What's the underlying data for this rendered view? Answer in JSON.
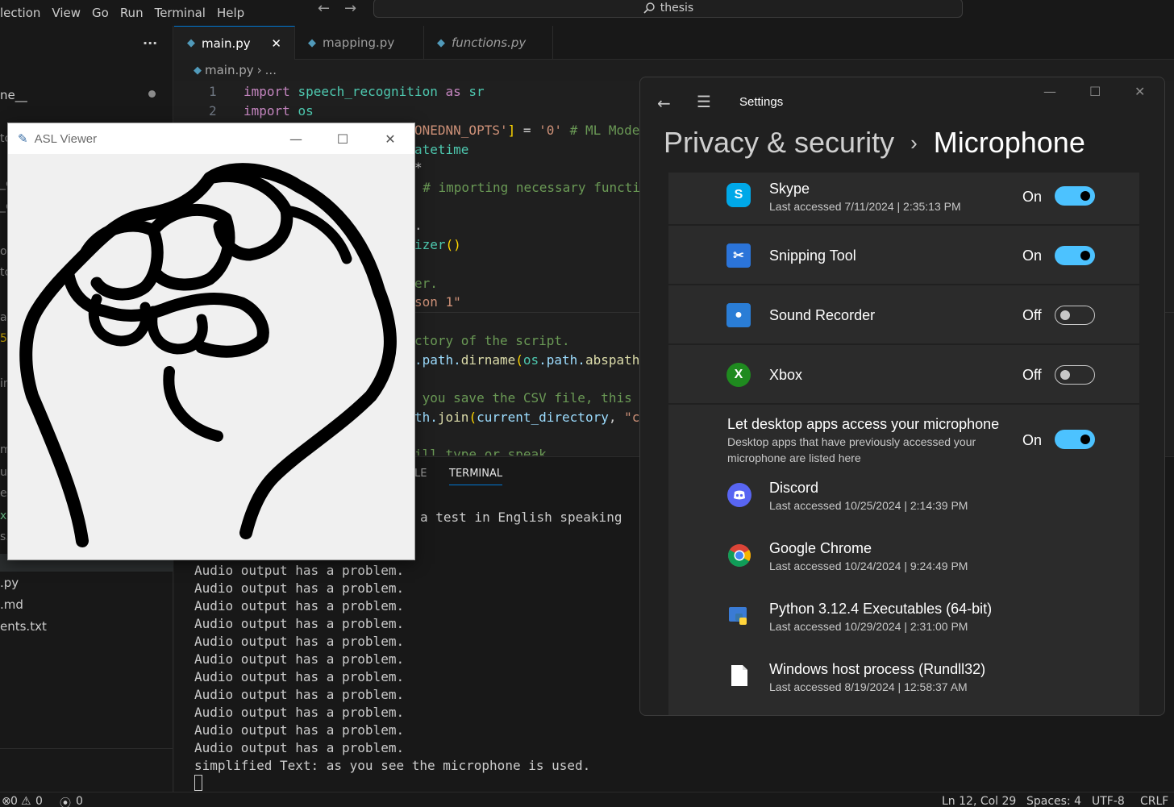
{
  "vscode": {
    "menu": [
      "lection",
      "View",
      "Go",
      "Run",
      "Terminal",
      "Help"
    ],
    "search_text": "thesis",
    "sidebar": {
      "more_label": "···",
      "folder_label": "ne__",
      "fragments": [
        "tc",
        "_c",
        "_c",
        "or",
        "tc",
        "a",
        "5",
        "in",
        "m",
        "u",
        "e",
        "x",
        "s."
      ],
      "files": [
        ".py",
        ".md",
        "ents.txt"
      ]
    },
    "tabs": [
      {
        "label": "main.py",
        "close": "✕"
      },
      {
        "label": "mapping.py"
      },
      {
        "label": "functions.py"
      }
    ],
    "breadcrumb": {
      "file": "main.py",
      "sep": "›",
      "rest": "..."
    },
    "line_numbers": [
      "1",
      "2"
    ],
    "code": {
      "l1_kw": "import",
      "l1_mod": "speech_recognition",
      "l1_as": "as",
      "l1_alias": "sr",
      "l2_kw": "import",
      "l2_mod": "os",
      "l3_str": "ONEDNN_OPTS'",
      "l3_br": "]",
      "l3_eq": " = ",
      "l3_val": "'0'",
      "l3_cm": " # ML Mode",
      "l4": "atetime",
      "l5": "*",
      "l6": "  # importing necessary functi",
      "l7": ".",
      "l8_a": "izer",
      "l8_b": "()",
      "l9": "er.",
      "l10": "son 1\"",
      "l11": "ctory of the script.",
      "l12_a": ".path.",
      "l12_b": "dirname",
      "l12_c": "(",
      "l12_d": "os",
      "l12_e": ".path.",
      "l12_f": "abspath",
      "l13": " you save the CSV file, this",
      "l14_a": "th.",
      "l14_b": "join",
      "l14_c": "(",
      "l14_d": "current_directory",
      "l14_e": ", ",
      "l14_f": "\"c",
      "l15": "ill type or speak"
    },
    "panel_tabs": [
      "LE",
      "TERMINAL"
    ],
    "terminal_lines": [
      "a test in English speaking",
      "Audio output has a problem.",
      "Audio output has a problem.",
      "Audio output has a problem.",
      "Audio output has a problem.",
      "Audio output has a problem.",
      "Audio output has a problem.",
      "Audio output has a problem.",
      "Audio output has a problem.",
      "Audio output has a problem.",
      "Audio output has a problem.",
      "Audio output has a problem.",
      "simplified Text: as you see the microphone is used."
    ],
    "status": {
      "errors": "0",
      "warnings": "0",
      "ports": "0",
      "position": "Ln 12, Col 29",
      "spaces": "Spaces: 4",
      "encoding": "UTF-8",
      "eol": "CRLF"
    }
  },
  "asl_viewer": {
    "title": "ASL Viewer",
    "minimize": "—",
    "maximize": "☐",
    "close": "✕"
  },
  "settings": {
    "app_name": "Settings",
    "breadcrumb_parent": "Privacy & security",
    "breadcrumb_sep": "›",
    "page_title": "Microphone",
    "apps": [
      {
        "name": "Skype",
        "sub": "Last accessed 7/11/2024  |  2:35:13 PM",
        "state": "On",
        "on": true,
        "icon_char": "S",
        "color": "#00a8e8"
      },
      {
        "name": "Snipping Tool",
        "sub": "",
        "state": "On",
        "on": true,
        "icon_char": "✂",
        "color": "#2b74d9"
      },
      {
        "name": "Sound Recorder",
        "sub": "",
        "state": "Off",
        "on": false,
        "icon_char": "●",
        "color": "#2a7dd6"
      },
      {
        "name": "Xbox",
        "sub": "",
        "state": "Off",
        "on": false,
        "icon_char": "X",
        "color": "#1f8a1f"
      }
    ],
    "desktop": {
      "title": "Let desktop apps access your microphone",
      "desc1": "Desktop apps that have previously accessed your",
      "desc2": "microphone are listed here",
      "state": "On",
      "apps": [
        {
          "name": "Discord",
          "sub": "Last accessed 10/25/2024  |  2:14:39 PM"
        },
        {
          "name": "Google Chrome",
          "sub": "Last accessed 10/24/2024  |  9:24:49 PM"
        },
        {
          "name": "Python 3.12.4 Executables (64-bit)",
          "sub": "Last accessed 10/29/2024  |  2:31:00 PM"
        },
        {
          "name": "Windows host process (Rundll32)",
          "sub": "Last accessed 8/19/2024  |  12:58:37 AM"
        }
      ]
    },
    "colors": {
      "accent": "#4cc2ff",
      "background": "#202020",
      "card": "#2b2b2b"
    }
  }
}
